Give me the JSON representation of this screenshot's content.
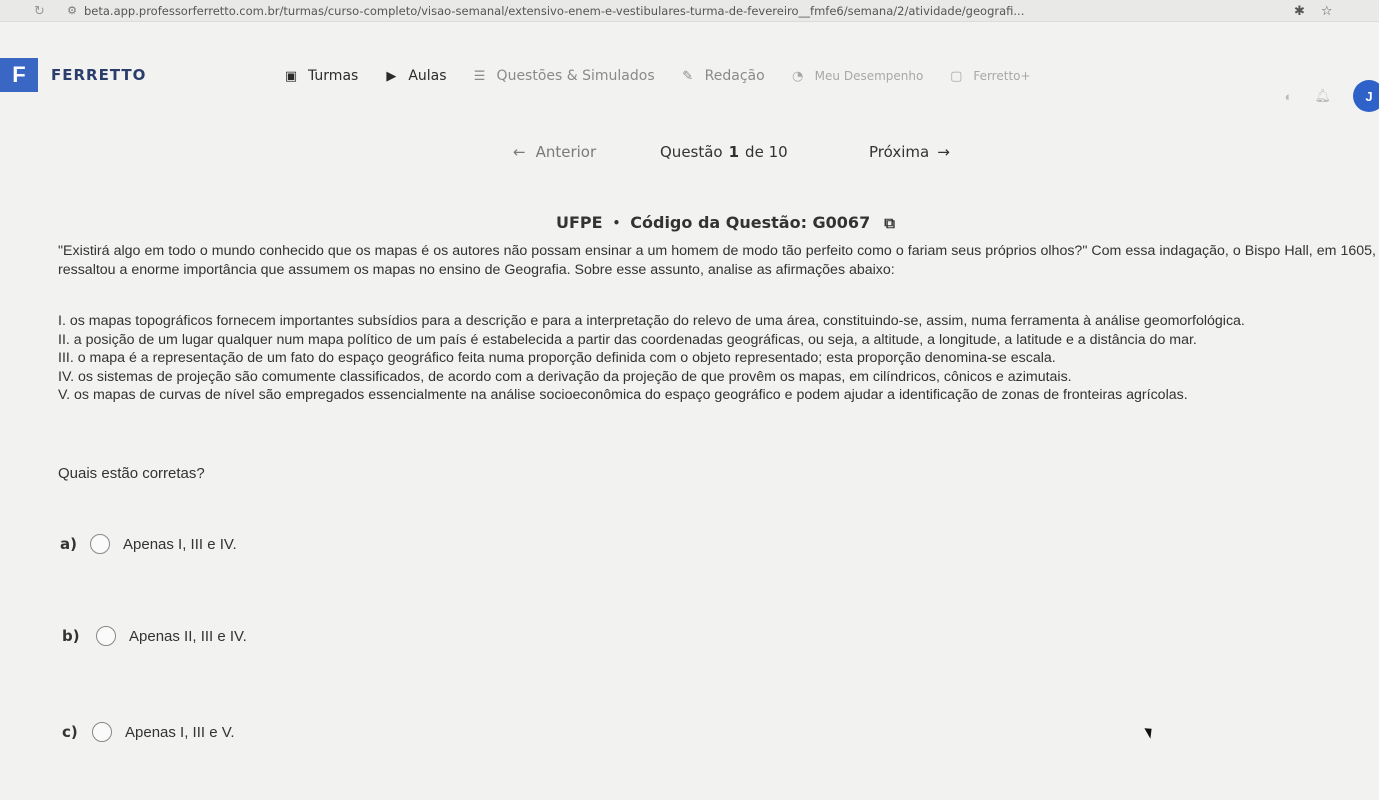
{
  "browser": {
    "url": "beta.app.professorferretto.com.br/turmas/curso-completo/visao-semanal/extensivo-enem-e-vestibulares-turma-de-fevereiro__fmfe6/semana/2/atividade/geografi..."
  },
  "brand": {
    "logo_letter": "F",
    "name": "FERRETTO",
    "color": "#3a66c4"
  },
  "menu": [
    {
      "label": "Turmas",
      "icon": "calendar-icon"
    },
    {
      "label": "Aulas",
      "icon": "play-icon"
    },
    {
      "label": "Questões & Simulados",
      "icon": "list-icon"
    },
    {
      "label": "Redação",
      "icon": "pencil-icon"
    },
    {
      "label": "Meu Desempenho",
      "icon": "clock-icon"
    },
    {
      "label": "Ferretto+",
      "icon": "box-icon"
    }
  ],
  "user": {
    "avatar_initial": "J",
    "avatar_color": "#2f62c8"
  },
  "question_nav": {
    "prev_label": "Anterior",
    "question_word": "Questão",
    "current": "1",
    "total_text": "de 10",
    "next_label": "Próxima"
  },
  "question": {
    "institution": "UFPE",
    "code_label": "Código da Questão: G0067",
    "statement": "\"Existirá algo em todo o mundo conhecido que os mapas é os autores não possam ensinar a um homem de modo tão perfeito como o fariam seus próprios olhos?\" Com essa indagação, o Bispo Hall, em 1605, ressaltou a enorme importância que assumem os mapas no ensino de Geografia. Sobre esse assunto, analise as afirmações abaixo:",
    "items": [
      "I. os mapas topográficos fornecem importantes subsídios para a descrição e para a interpretação do relevo de uma área, constituindo-se, assim, numa ferramenta à análise geomorfológica.",
      "II. a posição de um lugar qualquer num mapa político de um país é estabelecida a partir das coordenadas geográficas, ou seja, a altitude, a longitude, a latitude e a distância do mar.",
      "III. o mapa é a representação de um fato do espaço geográfico feita numa proporção definida com o objeto representado; esta proporção denomina-se escala.",
      "IV. os sistemas de projeção são comumente classificados, de acordo com a derivação da projeção de que provêm os mapas, em cilíndricos, cônicos e azimutais.",
      "V. os mapas de curvas de nível são empregados essencialmente na análise socioeconômica do espaço geográfico e podem ajudar a identificação de zonas de fronteiras agrícolas."
    ],
    "prompt": "Quais estão corretas?",
    "options": [
      {
        "letter": "a)",
        "text": "Apenas I, III e IV."
      },
      {
        "letter": "b)",
        "text": "Apenas II, III e IV."
      },
      {
        "letter": "c)",
        "text": "Apenas I, III e V."
      }
    ]
  }
}
